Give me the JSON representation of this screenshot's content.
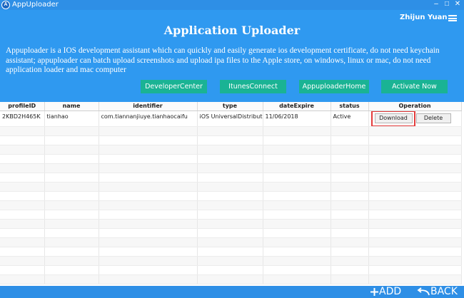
{
  "window": {
    "title": "AppUploader",
    "logo_text": "A",
    "minimize": "–",
    "maximize": "□",
    "close": "✕"
  },
  "header": {
    "user_name": "Zhijun Yuan",
    "heading": "Application Uploader",
    "description": "Appuploader is a IOS development assistant which can quickly and easily generate ios development certificate, do not need keychain assistant; appuploader can batch upload screenshots and upload ipa files to the Apple store, on windows, linux or mac, do not need application loader and mac computer"
  },
  "links": [
    {
      "label": "DeveloperCenter"
    },
    {
      "label": "ItunesConnect"
    },
    {
      "label": "AppuploaderHome"
    },
    {
      "label": "Activate Now"
    }
  ],
  "table": {
    "columns": [
      "profileID",
      "name",
      "identifier",
      "type",
      "dateExpire",
      "status",
      "Operation"
    ],
    "rows": [
      {
        "profileID": "2KBD2H465K",
        "name": "tianhao",
        "identifier": "com.tiannanjiuye.tianhaocaifu",
        "type": "iOS UniversalDistribution",
        "dateExpire": "11/06/2018",
        "status": "Active",
        "download_label": "Download",
        "delete_label": "Delete"
      }
    ]
  },
  "footer": {
    "add_label": "ADD",
    "back_label": "BACK"
  },
  "colors": {
    "background": "#2f99f0",
    "link_button": "#1ab394",
    "highlight": "#e33b3b"
  }
}
